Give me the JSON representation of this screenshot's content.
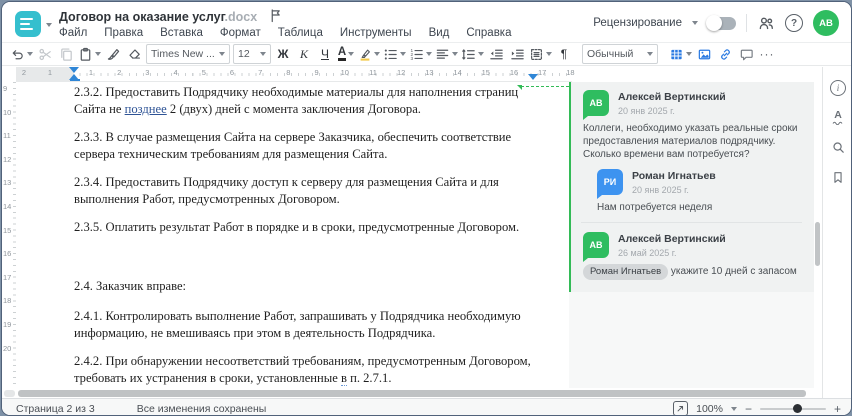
{
  "window": {
    "title": "Договор на оказание услуг",
    "ext": ".docx"
  },
  "menu": {
    "items": [
      "Файл",
      "Правка",
      "Вставка",
      "Формат",
      "Таблица",
      "Инструменты",
      "Вид",
      "Справка"
    ]
  },
  "header": {
    "review_label": "Рецензирование",
    "avatar_initials": "АВ"
  },
  "toolbar": {
    "font_name": "Times New ...",
    "font_size": "12",
    "bold_label": "Ж",
    "italic_label": "К",
    "underline_label": "Ч",
    "font_color_label": "А",
    "style_label": "Обычный",
    "pilcrow": "¶",
    "more_label": "···"
  },
  "ruler": {
    "h_left": [
      "2",
      "1"
    ],
    "h_main": [
      "1",
      "2",
      "3",
      "4",
      "5",
      "6",
      "7",
      "8",
      "9",
      "10",
      "11",
      "12",
      "13",
      "14",
      "15",
      "16",
      "17",
      "18"
    ],
    "v_main": [
      "9",
      "10",
      "11",
      "12",
      "13",
      "14",
      "15",
      "16",
      "17",
      "18",
      "19",
      "20"
    ]
  },
  "document": {
    "p1_a": "2.3.2. Предоставить Подрядчику необходимые материалы для наполнения страниц Сайта не ",
    "p1_ins": "позднее",
    "p1_b": " 2 (двух) дней с момента заключения Договора.",
    "p2": "2.3.3. В случае размещения Сайта на сервере Заказчика, обеспечить соответствие сервера техническим требованиям для размещения Сайта.",
    "p3": "2.3.4. Предоставить Подрядчику доступ к серверу для размещения Сайта и для выполнения Работ, предусмотренных Договором.",
    "p4": "2.3.5. Оплатить результат Работ в порядке и в сроки, предусмотренные Договором.",
    "p5": "2.4. Заказчик вправе:",
    "p6": "2.4.1. Контролировать выполнение Работ, запрашивать у Подрядчика необходимую информацию, не вмешиваясь при этом в деятельность Подрядчика.",
    "p7_a": "2.4.2. При обнаружении несоответствий требованиям, предусмотренным Договором, требовать их устранения в сроки, установленные ",
    "p7_w": "в",
    "p7_b": " п. 2.7.1."
  },
  "comments": {
    "threads": [
      {
        "initials": "АВ",
        "author": "Алексей Вертинский",
        "date": "20 янв 2025 г.",
        "text": "Коллеги, необходимо указать реальные сроки предоставления материалов подрядчику. Сколько времени вам потребуется?",
        "replies": [
          {
            "initials": "РИ",
            "author": "Роман Игнатьев",
            "date": "20 янв 2025 г.",
            "text": "Нам потребуется неделя"
          }
        ]
      },
      {
        "initials": "АВ",
        "author": "Алексей Вертинский",
        "date": "26 май 2025 г.",
        "mention": "Роман Игнатьев",
        "text": " укажите 10 дней с запасом"
      }
    ]
  },
  "statusbar": {
    "page": "Страница 2 из 3",
    "saved": "Все изменения сохранены",
    "zoom": "100%",
    "minus": "−",
    "plus": "+"
  },
  "colors": {
    "accent_teal": "#35bfce",
    "comment_green": "#33bb57",
    "avatar_green": "#2fbd60",
    "avatar_blue": "#3d93f0",
    "toolbar_blue": "#2a7ae2",
    "ruler_marker_blue": "#2f86d6"
  }
}
